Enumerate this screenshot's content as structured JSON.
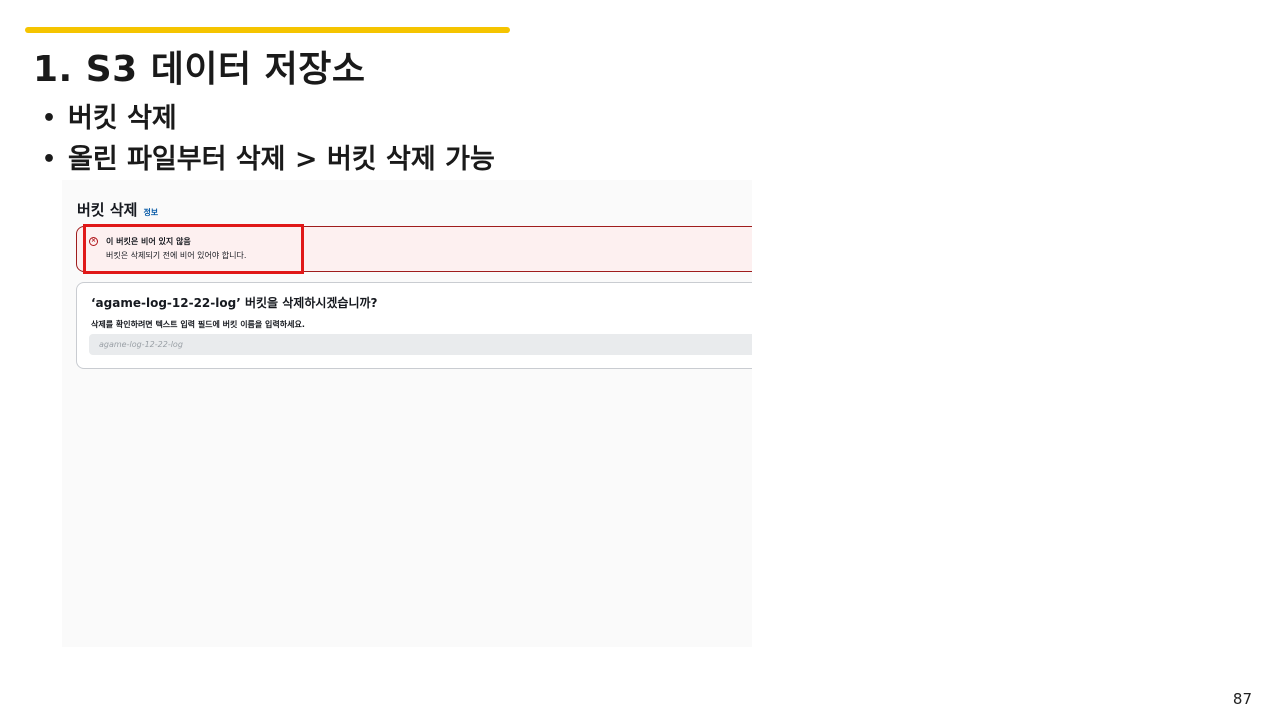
{
  "slide": {
    "title": "1. S3 데이터 저장소",
    "bullets": [
      "버킷 삭제",
      "올린 파일부터 삭제 > 버킷 삭제 가능"
    ],
    "page_number": "87",
    "accent_color": "#f5c400"
  },
  "screenshot": {
    "header": {
      "title": "버킷 삭제",
      "info_link": "정보"
    },
    "alert": {
      "type": "error",
      "icon": "error-circle-icon",
      "title": "이 버킷은 비어 있지 않음",
      "body": "버킷은 삭제되기 전에 비어 있어야 합니다.",
      "highlight_color": "#e01818"
    },
    "confirm": {
      "question": "‘agame-log-12-22-log’ 버킷을 삭제하시겠습니까?",
      "help_text": "삭제를 확인하려면 텍스트 입력 필드에 버킷 이름을 입력하세요.",
      "input_value": "",
      "input_placeholder": "agame-log-12-22-log"
    }
  }
}
